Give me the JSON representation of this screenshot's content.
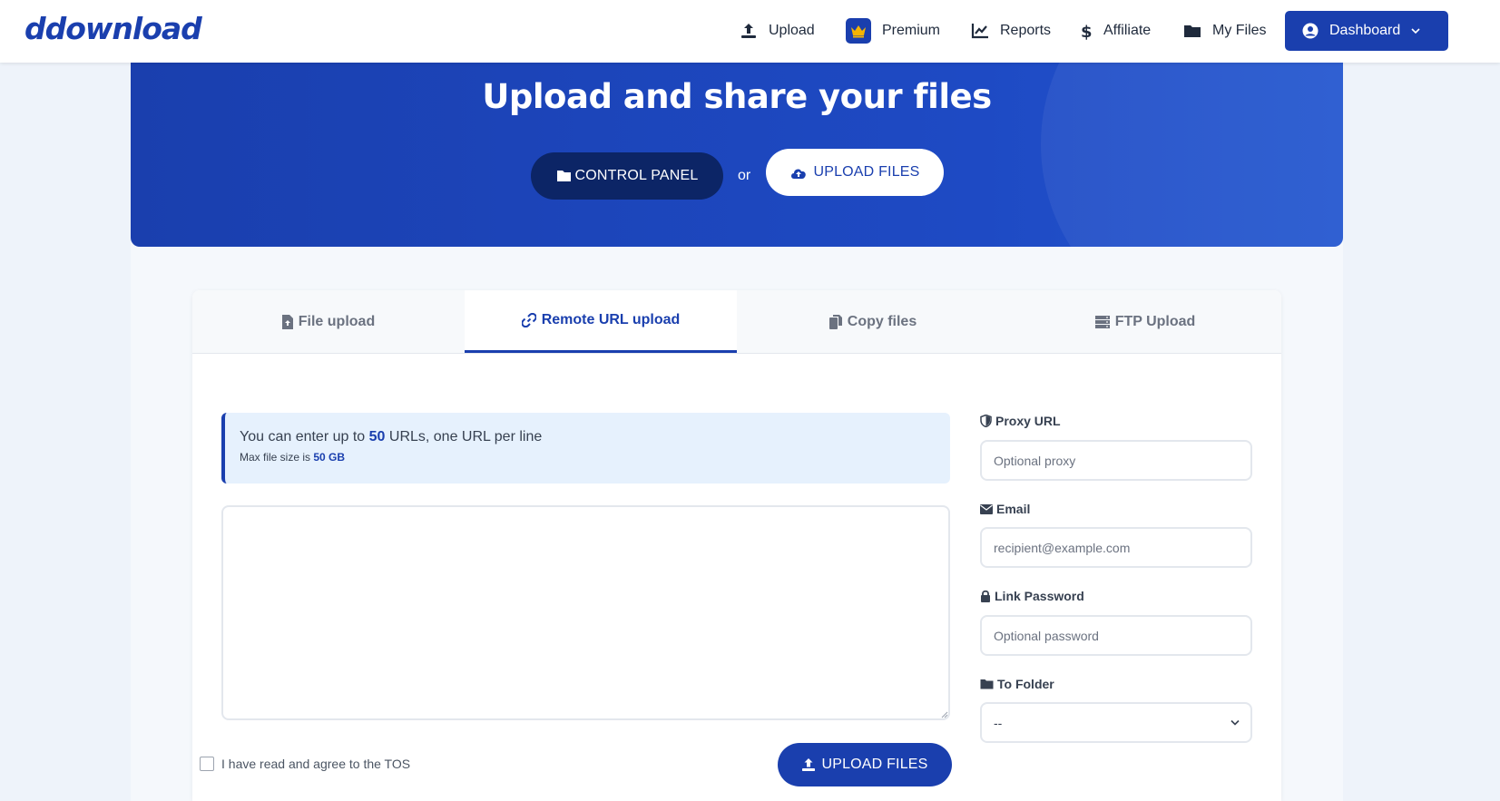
{
  "brand": {
    "logo_text": "ddownload",
    "accent": "#1a3fae",
    "dark": "#0c2566",
    "premium_crown": "#f5b400"
  },
  "nav": {
    "upload": "Upload",
    "premium": "Premium",
    "reports": "Reports",
    "affiliate": "Affiliate",
    "my_files": "My Files",
    "dashboard": "Dashboard"
  },
  "hero": {
    "title": "Upload and share your files",
    "control_panel": "CONTROL PANEL",
    "or": "or",
    "upload_files": "UPLOAD FILES"
  },
  "tabs": [
    {
      "label": "File upload",
      "icon": "file-upload-icon"
    },
    {
      "label": "Remote URL upload",
      "icon": "link-icon",
      "active": true
    },
    {
      "label": "Copy files",
      "icon": "copy-icon"
    },
    {
      "label": "FTP Upload",
      "icon": "server-icon"
    }
  ],
  "remote": {
    "notice_prefix": "You can enter up to ",
    "notice_count": "50",
    "notice_suffix": " URLs, one URL per line",
    "max_prefix": "Max file size is ",
    "max_size": "50 GB",
    "urls_value": "",
    "tos": "I have read and agree to the TOS",
    "submit": "UPLOAD FILES"
  },
  "options": {
    "proxy_label": "Proxy URL",
    "proxy_placeholder": "Optional proxy",
    "email_label": "Email",
    "email_placeholder": "recipient@example.com",
    "password_label": "Link Password",
    "password_placeholder": "Optional password",
    "folder_label": "To Folder",
    "folder_value": "--"
  }
}
